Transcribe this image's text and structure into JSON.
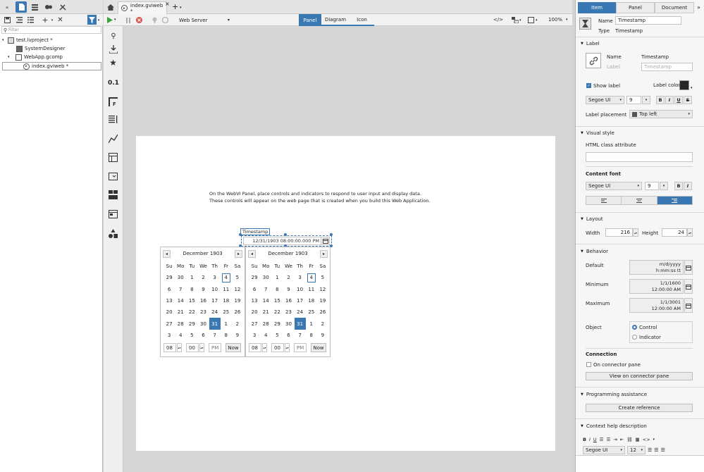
{
  "project_tree": {
    "filter_placeholder": "Filter",
    "items": [
      {
        "label": "test.lvproject *",
        "icon": "project-icon"
      },
      {
        "label": "SystemDesigner",
        "icon": "system-designer-icon"
      },
      {
        "label": "WebApp.gcomp",
        "icon": "component-icon"
      },
      {
        "label": "index.gviweb *",
        "icon": "webvi-icon"
      }
    ]
  },
  "document_tab": {
    "label": "index.gviweb *"
  },
  "toolbar": {
    "target": "Web Server",
    "view_tabs": [
      "Panel",
      "Diagram",
      "Icon"
    ],
    "zoom": "100%"
  },
  "palette": {
    "numeric_label": "0.1"
  },
  "panel": {
    "intro_line1": "On the WebVI Panel, place controls and indicators to respond to user input and display data.",
    "intro_line2": "These controls will appear on the web page that is created when you build this Web Application.",
    "timestamp_label": "Timestamp",
    "timestamp_value": "12/31/1903 08:00:00.000 PM"
  },
  "calendar": {
    "month_label": "December 1903",
    "weekdays": [
      "Su",
      "Mo",
      "Tu",
      "We",
      "Th",
      "Fr",
      "Sa"
    ],
    "days": [
      "29",
      "30",
      "1",
      "2",
      "3",
      "4",
      "5",
      "6",
      "7",
      "8",
      "9",
      "10",
      "11",
      "12",
      "13",
      "14",
      "15",
      "16",
      "17",
      "18",
      "19",
      "20",
      "21",
      "22",
      "23",
      "24",
      "25",
      "26",
      "27",
      "28",
      "29",
      "30",
      "31",
      "1",
      "2",
      "3",
      "4",
      "5",
      "6",
      "7",
      "8",
      "9"
    ],
    "selected_index": 32,
    "today_index": 5,
    "hour": "08",
    "minute": "00",
    "ampm": "PM",
    "now_label": "Now"
  },
  "properties": {
    "tabs": [
      "Item",
      "Panel",
      "Document"
    ],
    "name_label": "Name",
    "name_value": "Timestamp",
    "type_label": "Type",
    "type_value": "Timestamp",
    "label_section": "Label",
    "label_name_label": "Name",
    "label_name_value": "Timestamp",
    "label_label": "Label",
    "label_value": "Timestamp",
    "show_label": "Show label",
    "label_color": "Label color",
    "font": "Segoe UI",
    "font_size": "9",
    "label_placement_label": "Label placement",
    "label_placement_value": "Top left",
    "visual_style": "Visual style",
    "html_class_label": "HTML class attribute",
    "content_font": "Content font",
    "content_font_value": "Segoe UI",
    "content_font_size": "9",
    "layout": "Layout",
    "width_label": "Width",
    "width_value": "216",
    "height_label": "Height",
    "height_value": "24",
    "behavior": "Behavior",
    "default_label": "Default",
    "default_line1": "m/d/yyyy",
    "default_line2": "h:mm:ss tt",
    "minimum_label": "Minimum",
    "minimum_line1": "1/1/1600",
    "minimum_line2": "12:00:00 AM",
    "maximum_label": "Maximum",
    "maximum_line1": "1/1/3001",
    "maximum_line2": "12:00:00 AM",
    "object_label": "Object",
    "object_control": "Control",
    "object_indicator": "Indicator",
    "connection": "Connection",
    "on_connector_pane": "On connector pane",
    "view_connector_pane": "View on connector pane",
    "programming_assistance": "Programming assistance",
    "create_reference": "Create reference",
    "context_help": "Context help description",
    "help_font": "Segoe UI",
    "help_font_size": "12"
  },
  "colors": {
    "accent": "#3a78b4",
    "label_swatch": "#262626"
  }
}
